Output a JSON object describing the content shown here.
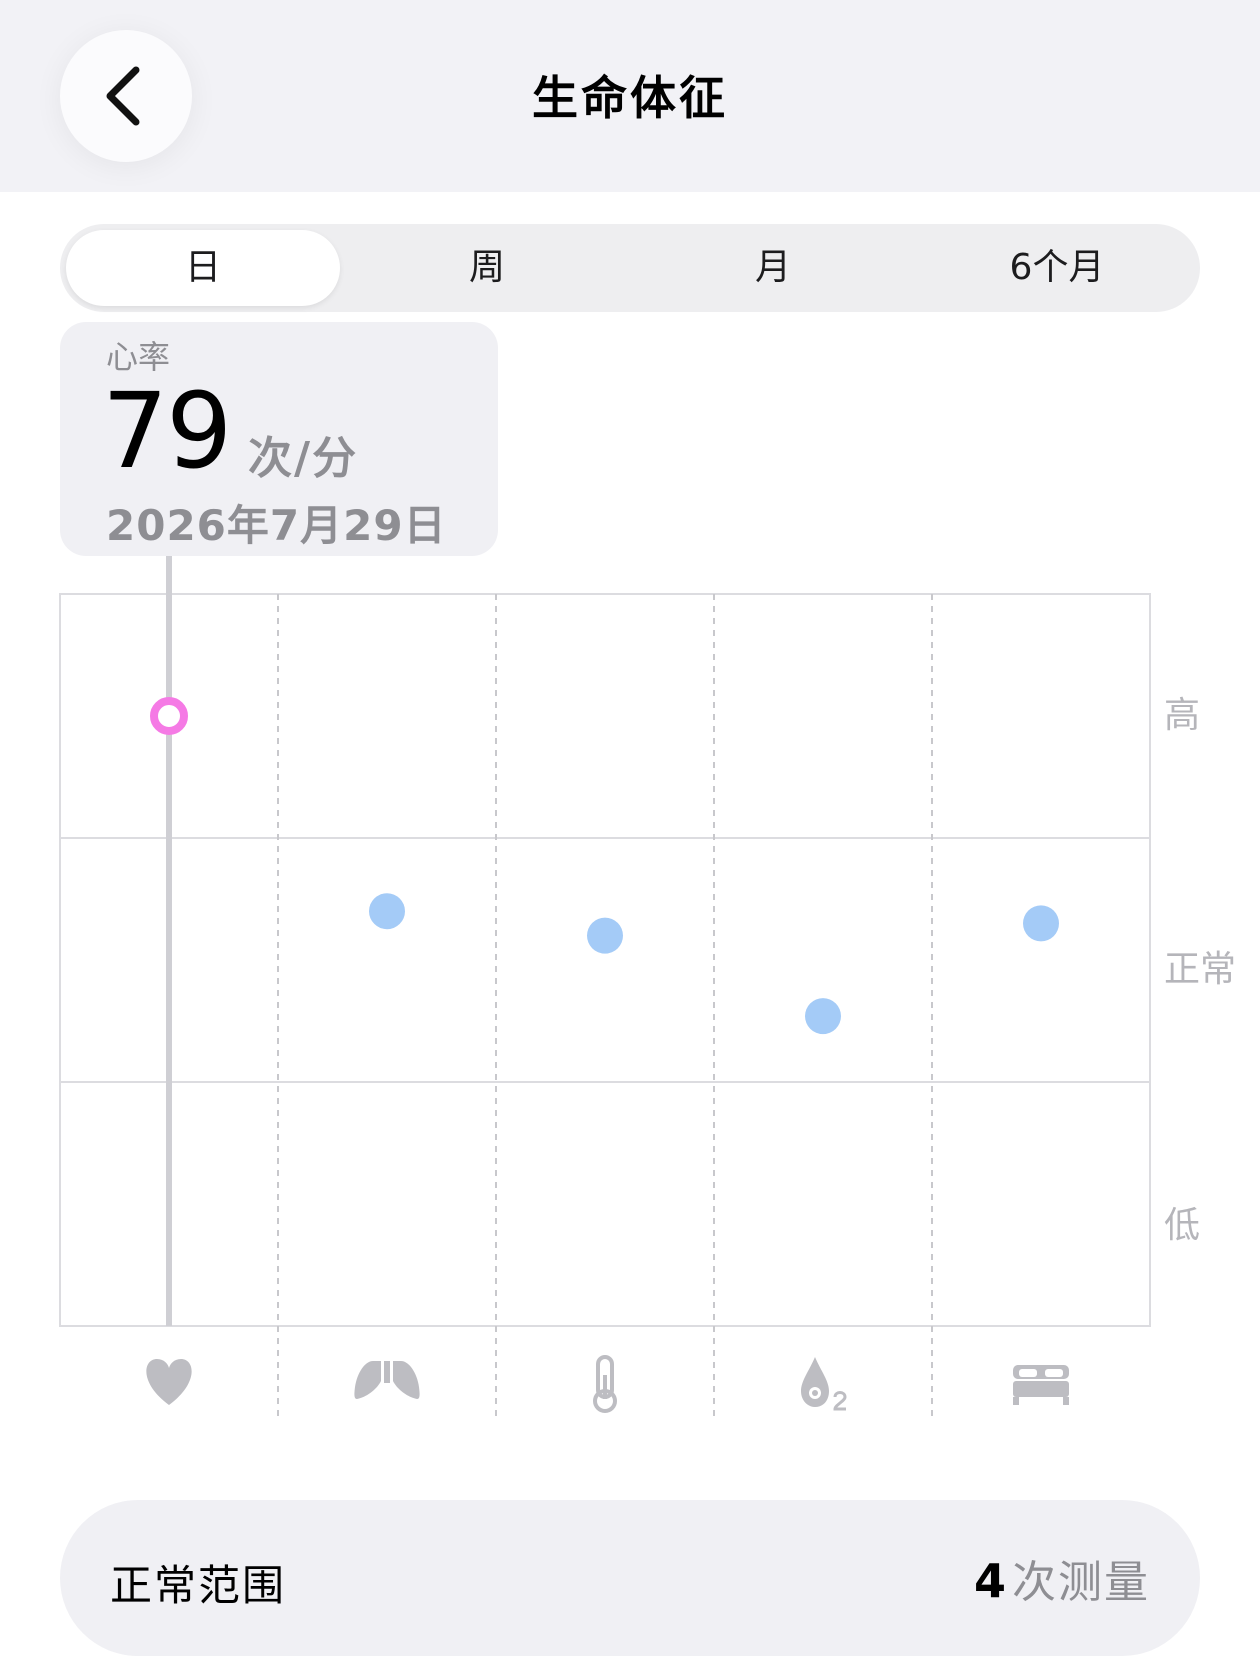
{
  "header": {
    "title": "生命体征"
  },
  "segments": [
    {
      "label": "日",
      "active": true
    },
    {
      "label": "周",
      "active": false
    },
    {
      "label": "月",
      "active": false
    },
    {
      "label": "6个月",
      "active": false
    }
  ],
  "tooltip": {
    "label": "心率",
    "value": "79",
    "unit": "次/分",
    "date": "2026年7月29日"
  },
  "chart_data": {
    "type": "scatter",
    "categories": [
      "heart-rate",
      "respiratory-rate",
      "body-temperature",
      "blood-oxygen",
      "sleep"
    ],
    "icons": [
      "heart-icon",
      "lungs-icon",
      "thermometer-icon",
      "blood-oxygen-icon",
      "bed-icon"
    ],
    "y_tick_labels": [
      "高",
      "正常",
      "低"
    ],
    "y_levels": {
      "低": 0,
      "正常": 1,
      "高": 2
    },
    "y_range": [
      -0.5,
      2.5
    ],
    "values": [
      2.0,
      1.2,
      1.1,
      0.77,
      1.15
    ],
    "selected_index": 0,
    "colors": {
      "selected": "#f57ae5",
      "normal": "#a4cbf7",
      "grid": "#dcdce0"
    }
  },
  "footer": {
    "title": "正常范围",
    "count": "4",
    "count_unit": "次测量"
  }
}
